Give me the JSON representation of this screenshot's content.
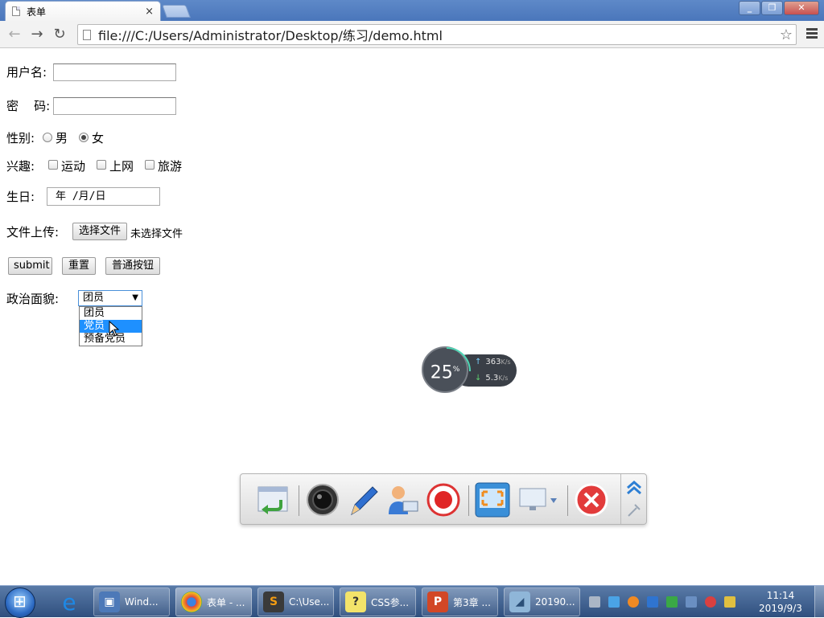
{
  "browser": {
    "tab_title": "表单",
    "tab_close": "×",
    "url": "file:///C:/Users/Administrator/Desktop/练习/demo.html",
    "back": "←",
    "forward": "→",
    "reload": "↻",
    "star": "☆",
    "window_buttons": [
      "_",
      "❐",
      "✕"
    ]
  },
  "form": {
    "username_label": "用户名:",
    "password_label": "密    码:",
    "gender_label": "性别:",
    "gender_male": "男",
    "gender_female": "女",
    "gender_selected": "女",
    "hobby_label": "兴趣:",
    "hobbies": [
      "运动",
      "上网",
      "旅游"
    ],
    "birthday_label": "生日:",
    "birthday_value": "年 /月/日",
    "upload_label": "文件上传:",
    "choose_file_button": "选择文件",
    "no_file_text": "未选择文件",
    "submit_button": "submit",
    "reset_button": "重置",
    "normal_button": "普通按钮",
    "political_label": "政治面貌:",
    "political_selected": "团员",
    "political_options": [
      "团员",
      "党员",
      "预备党员"
    ],
    "political_highlighted": "党员"
  },
  "net_widget": {
    "cpu_percent": "25",
    "percent_sign": "%",
    "upload_speed": "363",
    "download_speed": "5.3",
    "speed_unit": "K/s"
  },
  "taskbar": {
    "buttons": [
      "Wind...",
      "表单 - ...",
      "C:\\Use...",
      "CSS参...",
      "第3章 ...",
      "20190..."
    ],
    "time": "11:14",
    "date": "2019/9/3"
  }
}
